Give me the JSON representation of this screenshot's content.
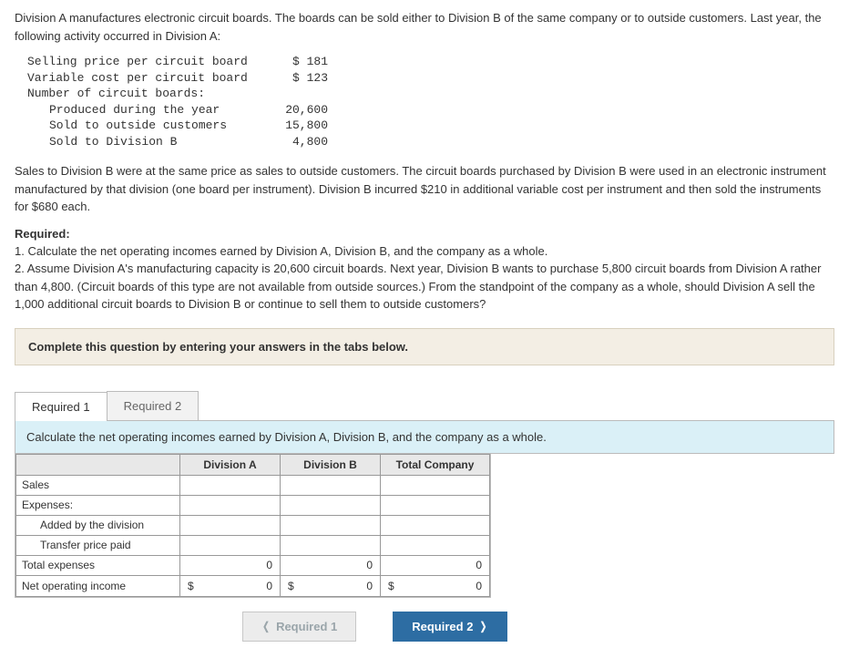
{
  "intro": "Division A manufactures electronic circuit boards. The boards can be sold either to Division B of the same company or to outside customers. Last year, the following activity occurred in Division A:",
  "data_rows": {
    "r1_label": "Selling price per circuit board",
    "r1_val": "$ 181",
    "r2_label": "Variable cost per circuit board",
    "r2_val": "$ 123",
    "r3_label": "Number of circuit boards:",
    "r4_label": "Produced during the year",
    "r4_val": "20,600",
    "r5_label": "Sold to outside customers",
    "r5_val": "15,800",
    "r6_label": "Sold to Division B",
    "r6_val": "4,800"
  },
  "para2": "Sales to Division B were at the same price as sales to outside customers. The circuit boards purchased by Division B were used in an electronic instrument manufactured by that division (one board per instrument). Division B incurred $210 in additional variable cost per instrument and then sold the instruments for $680 each.",
  "req_heading": "Required:",
  "req_text": "1. Calculate the net operating incomes earned by Division A, Division B, and the company as a whole.\n2. Assume Division A's manufacturing capacity is 20,600 circuit boards. Next year, Division B wants to purchase 5,800 circuit boards from Division A rather than 4,800. (Circuit boards of this type are not available from outside sources.) From the standpoint of the company as a whole, should Division A sell the 1,000 additional circuit boards to Division B or continue to sell them to outside customers?",
  "instruction": "Complete this question by entering your answers in the tabs below.",
  "tabs": {
    "t1": "Required 1",
    "t2": "Required 2"
  },
  "tab1_instruction": "Calculate the net operating incomes earned by Division A, Division B, and the company as a whole.",
  "headers": {
    "a": "Division A",
    "b": "Division B",
    "c": "Total Company"
  },
  "rows": {
    "sales": "Sales",
    "expenses": "Expenses:",
    "added": "Added by the division",
    "transfer": "Transfer price paid",
    "total_exp": "Total expenses",
    "noi": "Net operating income"
  },
  "zeros": {
    "z": "0"
  },
  "currency": "$",
  "btns": {
    "prev": "Required 1",
    "next": "Required 2"
  }
}
